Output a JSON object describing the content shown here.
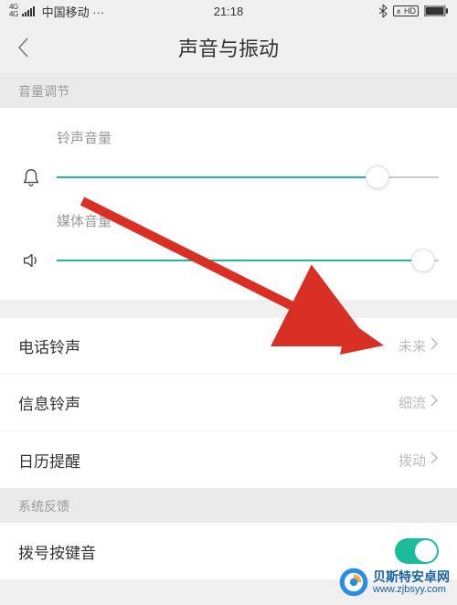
{
  "status_bar": {
    "network_tag": "4G",
    "carrier": "中国移动 ···",
    "time": "21:18",
    "hd": "HD"
  },
  "nav": {
    "title": "声音与振动"
  },
  "sections": {
    "volume_header": "音量调节",
    "system_header": "系统反馈"
  },
  "sliders": {
    "ringtone": {
      "label": "铃声音量",
      "value": 84
    },
    "media": {
      "label": "媒体音量",
      "value": 96
    }
  },
  "list": {
    "phone_ringtone": {
      "label": "电话铃声",
      "value": "未来"
    },
    "message_ringtone": {
      "label": "信息铃声",
      "value": "细流"
    },
    "calendar_reminder": {
      "label": "日历提醒",
      "value": "拨动"
    }
  },
  "toggles": {
    "dial_pad_tone": {
      "label": "拨号按键音",
      "on": true
    }
  },
  "colors": {
    "accent": "#1abc9c",
    "arrow": "#d93025"
  },
  "watermark": {
    "title": "贝斯特安卓网",
    "url": "www.zjbsyy.com"
  }
}
